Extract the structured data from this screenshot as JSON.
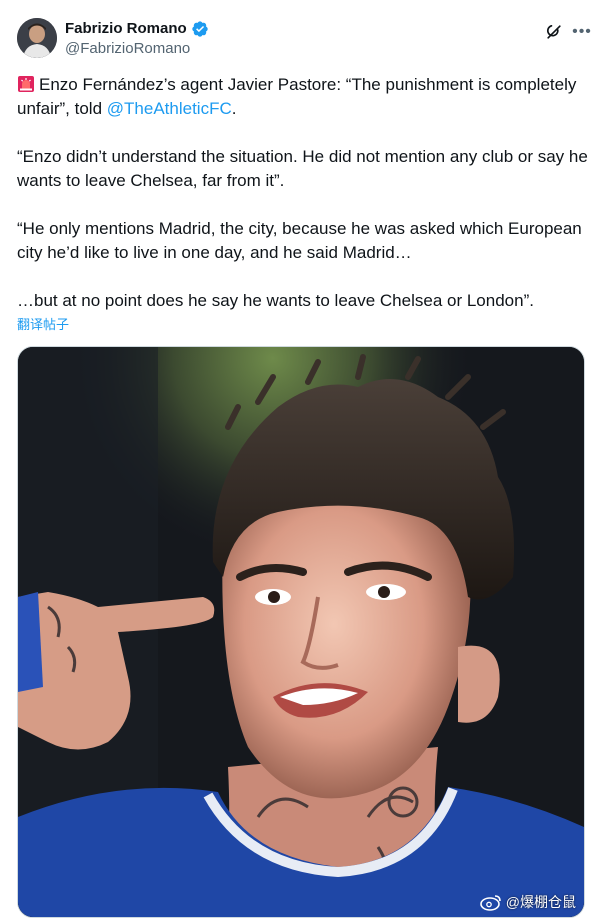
{
  "author": {
    "display_name": "Fabrizio Romano",
    "handle": "@FabrizioRomano",
    "verified": true,
    "verified_color": "#1d9bf0"
  },
  "icons": {
    "avatar": "profile-avatar",
    "verified": "verified-badge-icon",
    "grok": "grok-icon",
    "more": "more-icon",
    "siren": "siren-emoji-icon",
    "weibo": "weibo-icon"
  },
  "tweet": {
    "p1_text": "Enzo Fernández’s agent Javier Pastore: “The punishment is completely unfair”, told ",
    "p1_mention": "@TheAthleticFC",
    "p1_end": ".",
    "p2": "“Enzo didn’t understand the situation. He did not mention any club or say he wants to leave Chelsea, far from it”.",
    "p3": "“He only mentions Madrid, the city, because he was asked which European city he’d like to live in one day, and he said Madrid…",
    "p4": "…but at no point does he say he wants to leave Chelsea or London”.",
    "translate_label": "翻译帖子"
  },
  "media": {
    "watermark_text": "@爆棚仓鼠"
  },
  "colors": {
    "text": "#0f1419",
    "secondary": "#536471",
    "link": "#1d9bf0",
    "jersey": "#1f47a6"
  }
}
